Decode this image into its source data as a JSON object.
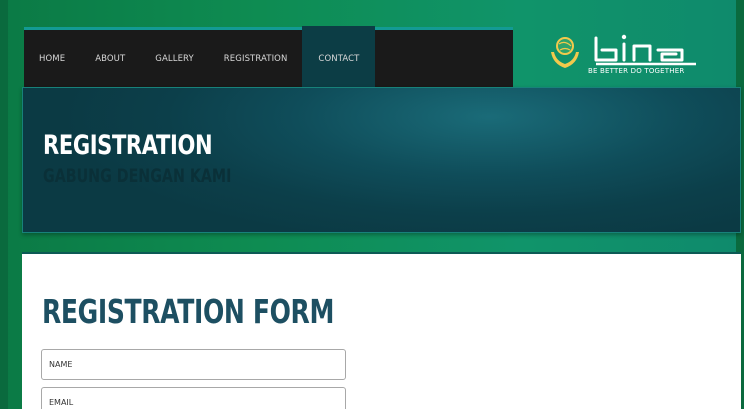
{
  "nav": {
    "items": [
      {
        "label": "HOME"
      },
      {
        "label": "ABOUT"
      },
      {
        "label": "GALLERY"
      },
      {
        "label": "REGISTRATION"
      },
      {
        "label": "CONTACT",
        "active": true
      }
    ]
  },
  "logo": {
    "wordmark": "bina",
    "tagline": "BE BETTER DO  TOGETHER"
  },
  "hero": {
    "title": "REGISTRATION",
    "subtitle": "GABUNG DENGAN KAMI"
  },
  "form": {
    "title": "REGISTRATION FORM",
    "name_placeholder": "NAME",
    "email_placeholder": "EMAIL"
  },
  "colors": {
    "background": "#0e8c52",
    "nav_bg": "#1a1a1a",
    "nav_active": "#0c3d45",
    "hero_bg": "#0f4d5a",
    "form_title": "#1d4f62"
  }
}
